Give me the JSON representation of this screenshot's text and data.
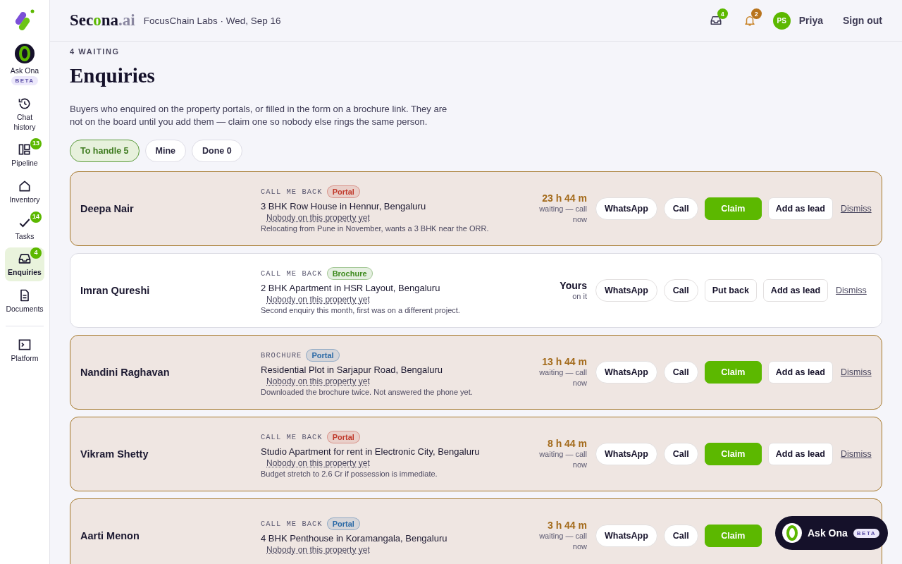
{
  "sidebar": {
    "ask": {
      "label": "Ask Ona",
      "badge": "BETA"
    },
    "items": [
      {
        "label": "Chat history",
        "selected": false
      },
      {
        "label": "Pipeline",
        "badge": "13",
        "selected": false
      },
      {
        "label": "Inventory",
        "selected": false
      },
      {
        "label": "Tasks",
        "badge": "14",
        "selected": false
      },
      {
        "label": "Enquiries",
        "badge": "4",
        "selected": true
      },
      {
        "label": "Documents",
        "selected": false
      }
    ],
    "footer_items": [
      {
        "label": "Platform",
        "selected": false
      }
    ]
  },
  "header": {
    "brand": [
      {
        "text": "Sec",
        "kind": "base"
      },
      {
        "text": "o",
        "kind": "accent"
      },
      {
        "text": "na",
        "kind": "base"
      },
      {
        "text": ".ai",
        "kind": "muted"
      }
    ],
    "context": "FocusChain Labs · Wed, Sep 16",
    "inbox_badge": "4",
    "alerts_badge": "2",
    "avatar": "PS",
    "user": "Priya",
    "sign_out": "Sign out"
  },
  "page": {
    "eyebrow": "4 WAITING",
    "title": "Enquiries",
    "intro": "Buyers who enquired on the property portals, or filled in the form on a brochure link. They are not on the board until you add them — claim one so nobody else rings the same person.",
    "filters": [
      {
        "label": "To handle 5",
        "selected": true
      },
      {
        "label": "Mine",
        "selected": false
      },
      {
        "label": "Done 0",
        "selected": false
      }
    ]
  },
  "enquiries": [
    {
      "name": "Deepa Nair",
      "claimed": false,
      "source": "CALL ME BACK",
      "tag": {
        "label": "Portal",
        "color": "#c0392b"
      },
      "property": "3 BHK Row House in Hennur, Bengaluru",
      "agent": "Nobody on this property yet",
      "note": "Relocating from Pune in November, wants a 3 BHK near the ORR.",
      "status": "23 h 44 m",
      "status_note": "waiting — call now",
      "buttons": [
        {
          "label": "WhatsApp",
          "kind": "pill"
        },
        {
          "label": "Call",
          "kind": "pill"
        },
        {
          "label": "Claim",
          "kind": "primary"
        },
        {
          "label": "Add as lead",
          "kind": "outline"
        },
        {
          "label": "Dismiss",
          "kind": "link"
        }
      ]
    },
    {
      "name": "Imran Qureshi",
      "claimed": true,
      "source": "CALL ME BACK",
      "tag": {
        "label": "Brochure",
        "color": "#3d8a1e"
      },
      "property": "2 BHK Apartment in HSR Layout, Bengaluru",
      "agent": "Nobody on this property yet",
      "note": "Second enquiry this month, first was on a different project.",
      "status": "Yours",
      "status_note": "on it",
      "buttons": [
        {
          "label": "WhatsApp",
          "kind": "pill"
        },
        {
          "label": "Call",
          "kind": "pill"
        },
        {
          "label": "Put back",
          "kind": "outline"
        },
        {
          "label": "Add as lead",
          "kind": "outline"
        },
        {
          "label": "Dismiss",
          "kind": "link"
        }
      ]
    },
    {
      "name": "Nandini Raghavan",
      "claimed": false,
      "source": "BROCHURE",
      "tag": {
        "label": "Portal",
        "color": "#2a69a6"
      },
      "property": "Residential Plot in Sarjapur Road, Bengaluru",
      "agent": "Nobody on this property yet",
      "note": "Downloaded the brochure twice. Not answered the phone yet.",
      "status": "13 h 44 m",
      "status_note": "waiting — call now",
      "buttons": [
        {
          "label": "WhatsApp",
          "kind": "pill"
        },
        {
          "label": "Call",
          "kind": "pill"
        },
        {
          "label": "Claim",
          "kind": "primary"
        },
        {
          "label": "Add as lead",
          "kind": "outline"
        },
        {
          "label": "Dismiss",
          "kind": "link"
        }
      ]
    },
    {
      "name": "Vikram Shetty",
      "claimed": false,
      "source": "CALL ME BACK",
      "tag": {
        "label": "Portal",
        "color": "#c0392b"
      },
      "property": "Studio Apartment for rent in Electronic City, Bengaluru",
      "agent": "Nobody on this property yet",
      "note": "Budget stretch to 2.6 Cr if possession is immediate.",
      "status": "8 h 44 m",
      "status_note": "waiting — call now",
      "buttons": [
        {
          "label": "WhatsApp",
          "kind": "pill"
        },
        {
          "label": "Call",
          "kind": "pill"
        },
        {
          "label": "Claim",
          "kind": "primary"
        },
        {
          "label": "Add as lead",
          "kind": "outline"
        },
        {
          "label": "Dismiss",
          "kind": "link"
        }
      ]
    },
    {
      "name": "Aarti Menon",
      "claimed": false,
      "source": "CALL ME BACK",
      "tag": {
        "label": "Portal",
        "color": "#2a69a6"
      },
      "property": "4 BHK Penthouse in Koramangala, Bengaluru",
      "agent": "Nobody on this property yet",
      "status": "3 h 44 m",
      "status_note": "waiting — call now",
      "buttons": [
        {
          "label": "WhatsApp",
          "kind": "pill"
        },
        {
          "label": "Call",
          "kind": "pill"
        },
        {
          "label": "Claim",
          "kind": "primary"
        }
      ]
    }
  ],
  "assistant": {
    "label": "Ask Ona",
    "badge": "BETA"
  }
}
